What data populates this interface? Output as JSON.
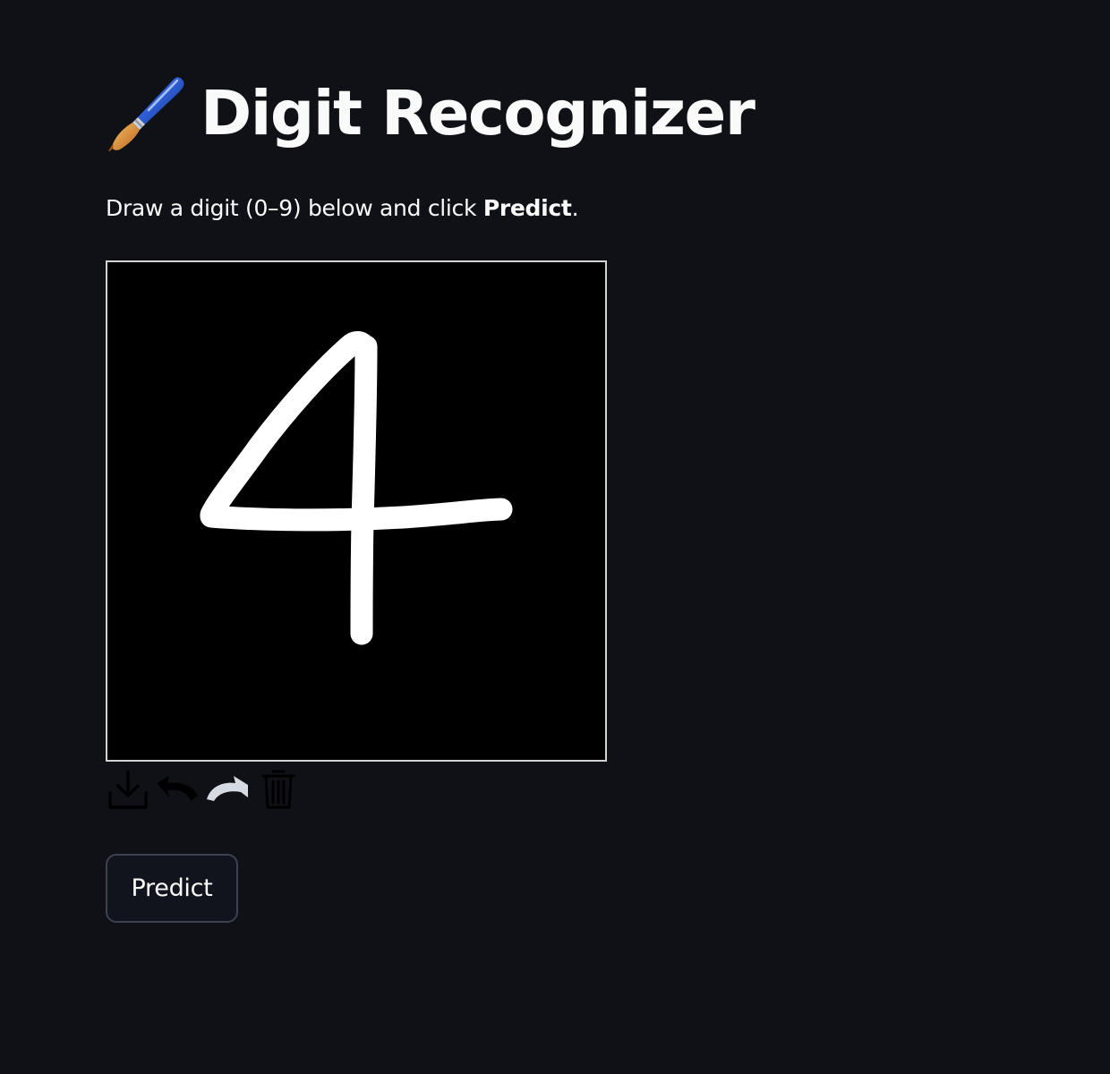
{
  "app": {
    "title": "Digit Recognizer",
    "title_icon": "paintbrush-icon"
  },
  "description": {
    "prefix": "Draw a digit (0–9) below and click ",
    "emphasis": "Predict",
    "suffix": "."
  },
  "canvas": {
    "background_color": "#000000",
    "stroke_color": "#ffffff",
    "drawn_digit": "4"
  },
  "toolbar": {
    "items": [
      {
        "name": "download-icon",
        "state": "disabled"
      },
      {
        "name": "undo-icon",
        "state": "disabled"
      },
      {
        "name": "redo-icon",
        "state": "enabled"
      },
      {
        "name": "trash-icon",
        "state": "disabled"
      }
    ]
  },
  "predict_button": {
    "label": "Predict"
  },
  "colors": {
    "background": "#0f1117",
    "text": "#fafafa",
    "button_border": "#3e4150",
    "canvas_border": "#d2d2d2"
  }
}
